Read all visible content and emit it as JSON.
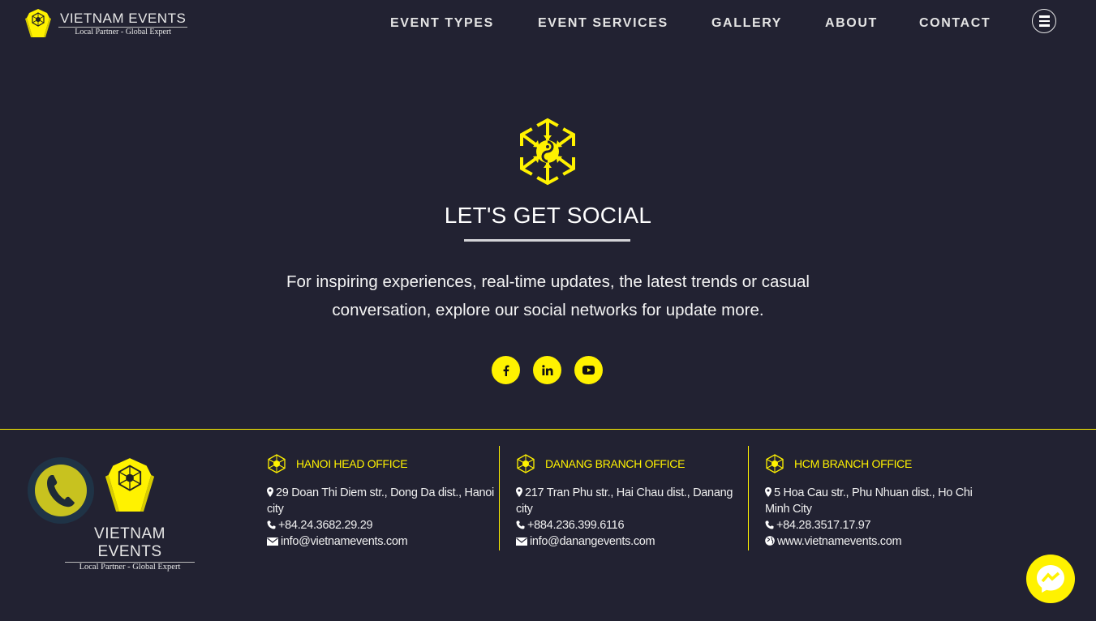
{
  "header": {
    "logo": {
      "title": "VIETNAM EVENTS",
      "subtitle": "Local Partner - Global Expert",
      "icon": "hexagon-shield-logo-icon"
    },
    "nav": [
      {
        "label": "EVENT TYPES"
      },
      {
        "label": "EVENT SERVICES"
      },
      {
        "label": "GALLERY"
      },
      {
        "label": "ABOUT"
      },
      {
        "label": "CONTACT"
      }
    ],
    "menu_icon": "hamburger-menu-icon"
  },
  "social": {
    "icon": "hexagon-network-icon",
    "title": "LET'S GET SOCIAL",
    "description": "For inspiring experiences, real-time updates, the latest trends or casual conversation, explore our social networks for update more.",
    "links": [
      {
        "name": "facebook",
        "icon": "facebook-icon"
      },
      {
        "name": "linkedin",
        "icon": "linkedin-icon"
      },
      {
        "name": "youtube",
        "icon": "youtube-icon"
      }
    ]
  },
  "footer": {
    "call_icon": "phone-call-icon",
    "logo": {
      "title": "VIETNAM EVENTS",
      "subtitle": "Local Partner - Global Expert"
    },
    "offices": [
      {
        "title": "HANOI HEAD OFFICE",
        "address": "29 Doan Thi Diem str., Dong Da dist., Hanoi city",
        "phone": "+84.24.3682.29.29",
        "contact": "info@vietnamevents.com",
        "contact_icon": "envelope-icon"
      },
      {
        "title": "DANANG BRANCH OFFICE",
        "address": "217 Tran Phu str., Hai Chau dist., Danang city",
        "phone": "+884.236.399.6116",
        "contact": "info@danangevents.com",
        "contact_icon": "envelope-icon"
      },
      {
        "title": "HCM BRANCH OFFICE",
        "address": "5 Hoa Cau str., Phu Nhuan dist., Ho Chi Minh City",
        "phone": "+84.28.3517.17.97",
        "contact": "www.vietnamevents.com",
        "contact_icon": "globe-icon"
      }
    ],
    "messenger_icon": "messenger-icon"
  },
  "colors": {
    "background": "#222232",
    "accent": "#fff200",
    "text": "#ffffff"
  }
}
